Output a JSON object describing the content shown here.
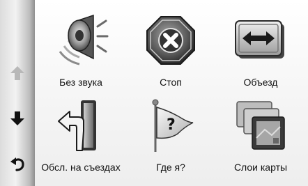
{
  "sidebar": {
    "buttons": [
      {
        "icon": "arrow-up-icon",
        "enabled": false
      },
      {
        "icon": "arrow-down-icon",
        "enabled": true
      },
      {
        "icon": "back-icon",
        "enabled": true
      }
    ]
  },
  "menu": {
    "items": [
      {
        "label": "Без звука",
        "icon": "speaker-mute-icon"
      },
      {
        "label": "Стоп",
        "icon": "stop-icon"
      },
      {
        "label": "Объезд",
        "icon": "detour-icon"
      },
      {
        "label": "Обсл. на съездах",
        "icon": "exit-services-icon"
      },
      {
        "label": "Где я?",
        "icon": "where-am-i-icon"
      },
      {
        "label": "Слои карты",
        "icon": "map-layers-icon"
      }
    ]
  }
}
